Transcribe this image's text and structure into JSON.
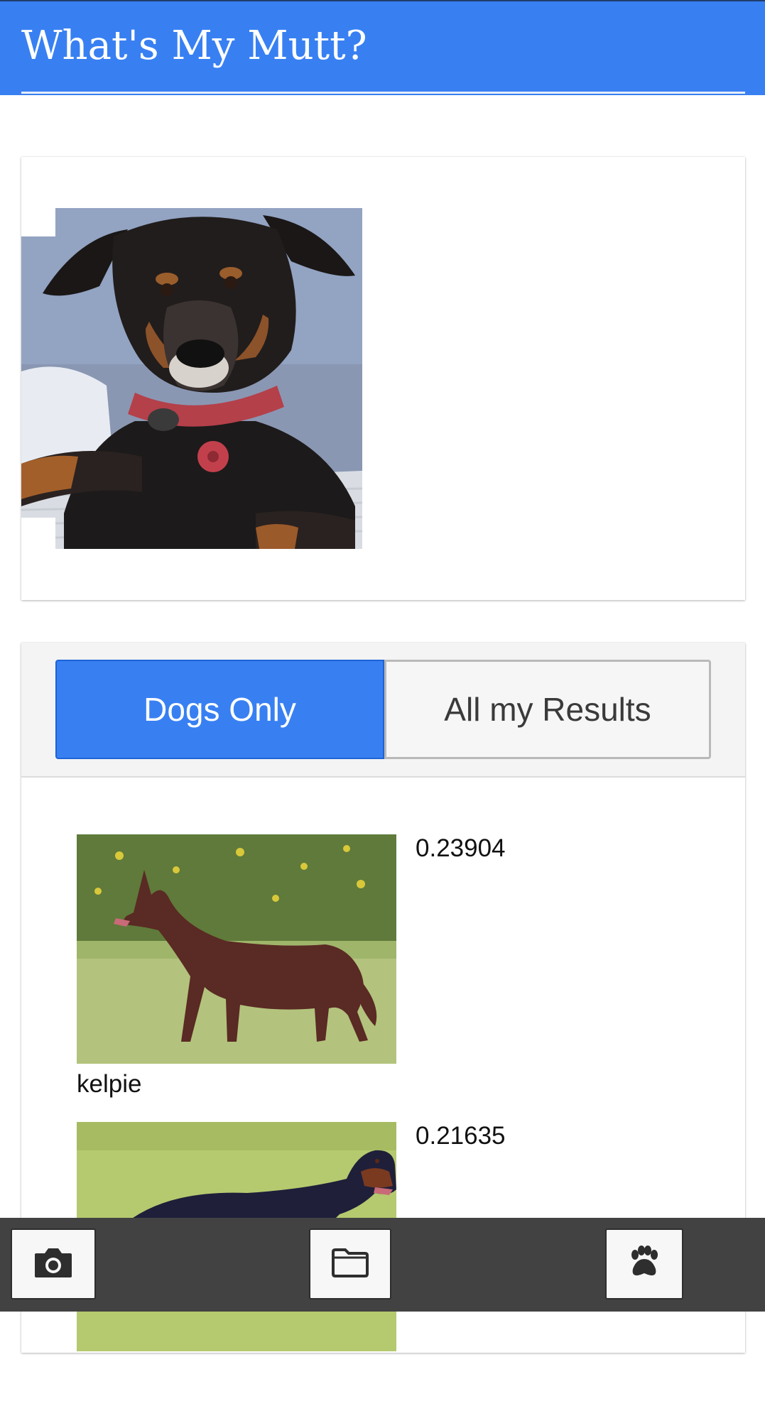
{
  "header": {
    "title": "What's My Mutt?"
  },
  "photo_card": {
    "image_alt": "uploaded dog photo"
  },
  "tabs": [
    {
      "label": "Dogs Only",
      "active": true
    },
    {
      "label": "All my Results",
      "active": false
    }
  ],
  "results": [
    {
      "breed": "kelpie",
      "score": "0.23904"
    },
    {
      "breed": "",
      "score": "0.21635"
    }
  ],
  "toolbar": {
    "buttons": [
      {
        "icon": "camera-icon"
      },
      {
        "icon": "folder-icon"
      },
      {
        "icon": "paw-icon"
      }
    ]
  },
  "colors": {
    "brand": "#3880f2",
    "toolbar": "#424242",
    "tab_inactive_bg": "#f6f6f6"
  }
}
